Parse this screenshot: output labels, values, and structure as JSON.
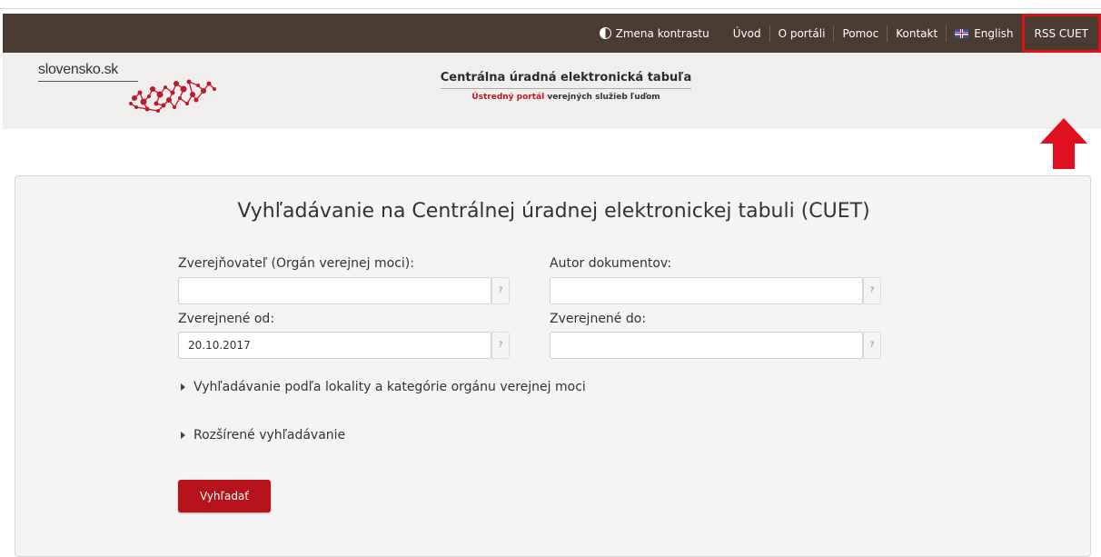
{
  "topnav": {
    "contrast": "Zmena kontrastu",
    "uvod": "Úvod",
    "o_portali": "O portáli",
    "pomoc": "Pomoc",
    "kontakt": "Kontakt",
    "english": "English",
    "rss": "RSS CUET"
  },
  "brand": {
    "logo": "slovensko.sk",
    "title": "Centrálna úradná elektronická tabuľa",
    "subtitle_accent": "Ústredný portál",
    "subtitle_rest": " verejných služieb ľuďom"
  },
  "search": {
    "heading": "Vyhľadávanie na Centrálnej úradnej elektronickej tabuli (CUET)",
    "publisher_label": "Zverejňovateľ (Orgán verejnej moci):",
    "publisher_value": "",
    "author_label": "Autor dokumentov:",
    "author_value": "",
    "from_label": "Zverejnené od:",
    "from_value": "20.10.2017",
    "to_label": "Zverejnené do:",
    "to_value": "",
    "help": "?",
    "location_toggle": "Vyhľadávanie podľa lokality a kategórie orgánu verejnej moci",
    "advanced_toggle": "Rozšírené vyhľadávanie",
    "submit": "Vyhľadať"
  },
  "colors": {
    "topbar": "#4a3b33",
    "brandbar": "#f1efed",
    "accent_red": "#b5121b",
    "highlight": "#e0101a"
  }
}
